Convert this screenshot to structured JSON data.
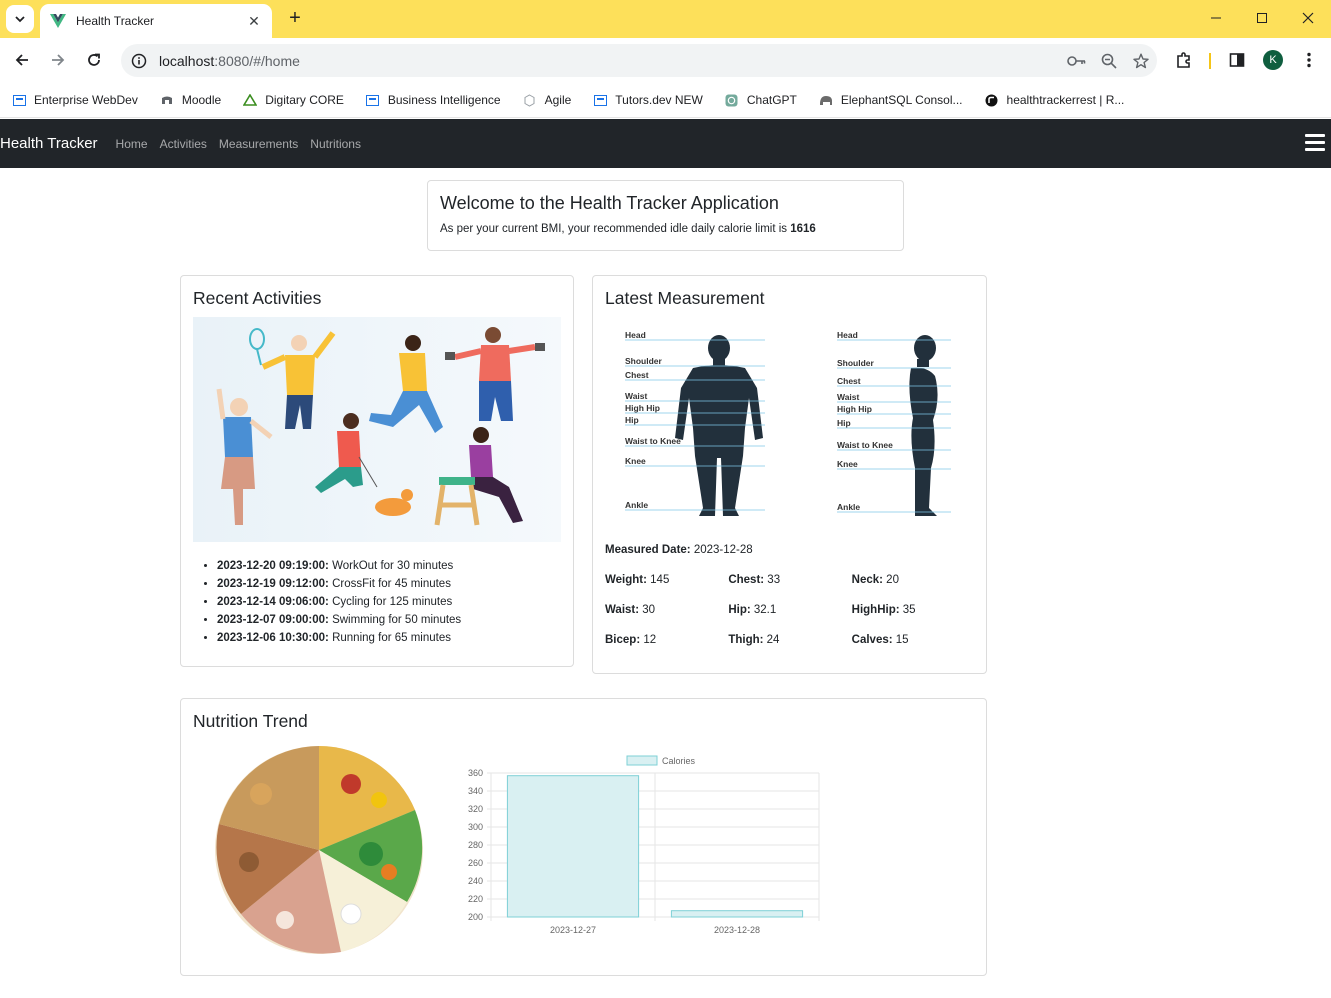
{
  "browser": {
    "tab_title": "Health Tracker",
    "url_host": "localhost",
    "url_rest": ":8080/#/home",
    "profile_initial": "K"
  },
  "bookmarks": [
    {
      "label": "Enterprise WebDev",
      "icon": "page-icon"
    },
    {
      "label": "Moodle",
      "icon": "moodle-icon"
    },
    {
      "label": "Digitary CORE",
      "icon": "triangle-icon"
    },
    {
      "label": "Business Intelligence",
      "icon": "page-icon"
    },
    {
      "label": "Agile",
      "icon": "globe-icon"
    },
    {
      "label": "Tutors.dev NEW",
      "icon": "page-icon"
    },
    {
      "label": "ChatGPT",
      "icon": "chatgpt-icon"
    },
    {
      "label": "ElephantSQL Consol...",
      "icon": "elephant-icon"
    },
    {
      "label": "healthtrackerrest | R...",
      "icon": "render-icon"
    }
  ],
  "navbar": {
    "brand": "Health Tracker",
    "links": [
      "Home",
      "Activities",
      "Measurements",
      "Nutritions"
    ]
  },
  "welcome": {
    "title": "Welcome to the Health Tracker Application",
    "text": "As per your current BMI, your recommended idle daily calorie limit is ",
    "calorie_limit": "1616"
  },
  "activities": {
    "title": "Recent Activities",
    "items": [
      {
        "time": "2023-12-20 09:19:00:",
        "text": " WorkOut for 30 minutes"
      },
      {
        "time": "2023-12-19 09:12:00:",
        "text": " CrossFit for 45 minutes"
      },
      {
        "time": "2023-12-14 09:06:00:",
        "text": " Cycling for 125 minutes"
      },
      {
        "time": "2023-12-07 09:00:00:",
        "text": " Swimming for 50 minutes"
      },
      {
        "time": "2023-12-06 10:30:00:",
        "text": " Running for 65 minutes"
      }
    ]
  },
  "measurement": {
    "title": "Latest Measurement",
    "front_labels": [
      "Head",
      "Shoulder",
      "Chest",
      "Waist",
      "High Hip",
      "Hip",
      "Waist to Knee",
      "Knee",
      "Ankle"
    ],
    "side_labels": [
      "Head",
      "Shoulder",
      "Chest",
      "Waist",
      "High Hip",
      "Hip",
      "Waist to Knee",
      "Knee",
      "Ankle"
    ],
    "date_label": "Measured Date:",
    "date_value": " 2023-12-28",
    "rows": [
      [
        {
          "label": "Weight:",
          "value": " 145"
        },
        {
          "label": "Chest:",
          "value": " 33"
        },
        {
          "label": "Neck:",
          "value": " 20"
        }
      ],
      [
        {
          "label": "Waist:",
          "value": " 30"
        },
        {
          "label": "Hip:",
          "value": " 32.1"
        },
        {
          "label": "HighHip:",
          "value": " 35"
        }
      ],
      [
        {
          "label": "Bicep:",
          "value": " 12"
        },
        {
          "label": "Thigh:",
          "value": " 24"
        },
        {
          "label": "Calves:",
          "value": " 15"
        }
      ]
    ]
  },
  "nutrition": {
    "title": "Nutrition Trend"
  },
  "chart_data": {
    "type": "bar",
    "categories": [
      "2023-12-27",
      "2023-12-28"
    ],
    "series": [
      {
        "name": "Calories",
        "values": [
          357,
          207
        ]
      }
    ],
    "ylim": [
      200,
      360
    ],
    "yticks": [
      360,
      340,
      320,
      300,
      280,
      260,
      240,
      220,
      200
    ],
    "legend": "top",
    "grid": true,
    "bar_fill": "#d9f0f2",
    "bar_stroke": "#7ed0d6"
  }
}
